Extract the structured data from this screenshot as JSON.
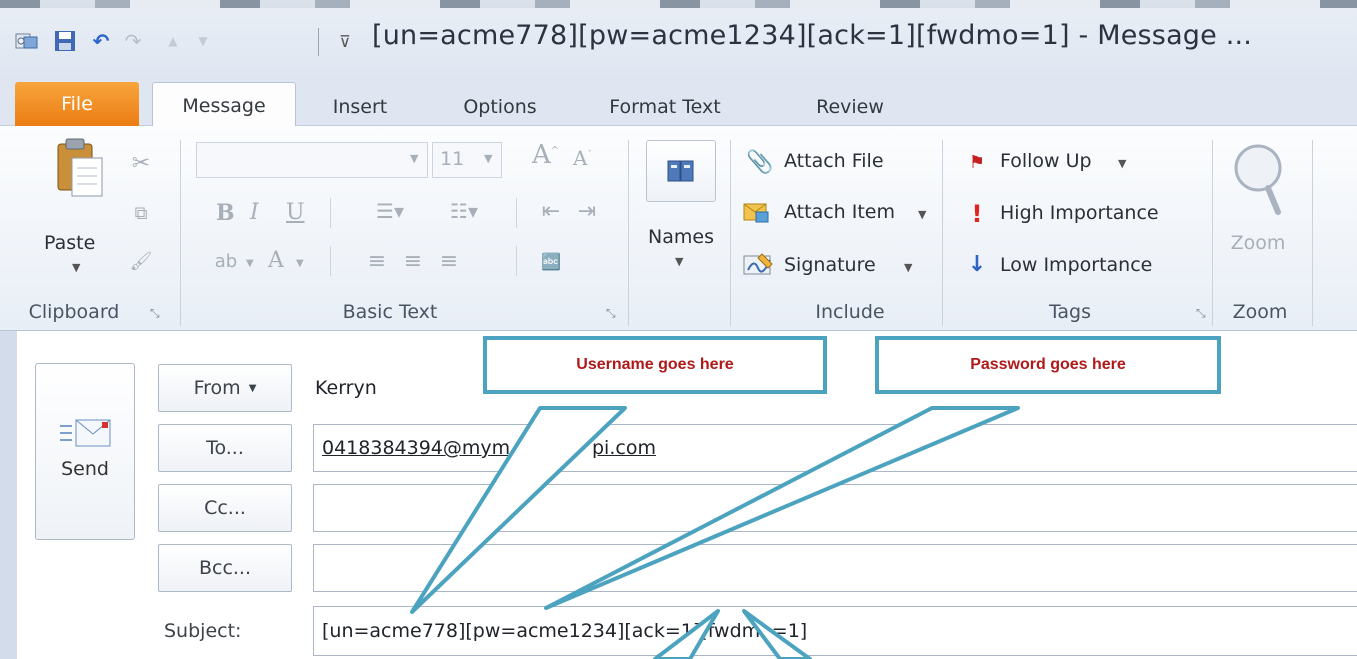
{
  "window": {
    "title": "[un=acme778][pw=acme1234][ack=1][fwdmo=1]  - Message ..."
  },
  "quick_access": {
    "icons": [
      "outlook-icon",
      "save-icon",
      "undo-icon",
      "redo-icon",
      "up-arrow-icon",
      "down-arrow-icon",
      "customize-icon"
    ]
  },
  "tabs": [
    {
      "label": "File"
    },
    {
      "label": "Message"
    },
    {
      "label": "Insert"
    },
    {
      "label": "Options"
    },
    {
      "label": "Format Text"
    },
    {
      "label": "Review"
    }
  ],
  "ribbon": {
    "clipboard": {
      "paste_label": "Paste",
      "group_label": "Clipboard"
    },
    "basic_text": {
      "font_size": "11",
      "bold": "B",
      "italic": "I",
      "underline": "U",
      "font_color": "A",
      "group_label": "Basic Text"
    },
    "names": {
      "label": "Names"
    },
    "include": {
      "attach_file": "Attach File",
      "attach_item": "Attach Item",
      "signature": "Signature",
      "group_label": "Include"
    },
    "tags": {
      "follow_up": "Follow Up",
      "high_importance": "High Importance",
      "low_importance": "Low Importance",
      "group_label": "Tags"
    },
    "zoom": {
      "label": "Zoom",
      "group_label": "Zoom"
    }
  },
  "compose": {
    "send_label": "Send",
    "from_label": "From",
    "from_value": "Kerryn",
    "to_label": "To...",
    "to_value": "0418384394@mym",
    "to_value_tail": "pi.com",
    "cc_label": "Cc...",
    "bcc_label": "Bcc...",
    "subject_label": "Subject:",
    "subject_value": "[un=acme778][pw=acme1234][ack=1][fwdmo=1]"
  },
  "callouts": {
    "username": "Username goes here",
    "password": "Password goes here"
  },
  "colors": {
    "callout_border": "#4ba3bf",
    "callout_text": "#b01919",
    "file_tab": "#ec7d14"
  }
}
